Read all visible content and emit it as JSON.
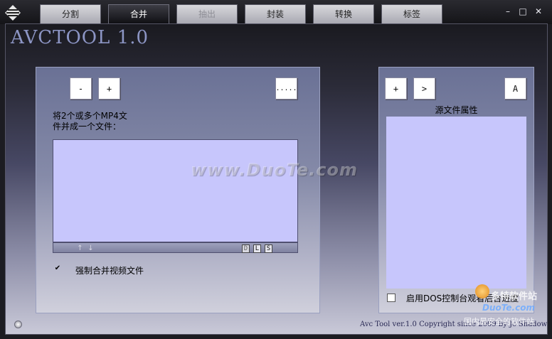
{
  "tabs": [
    {
      "label": "分割",
      "state": "normal"
    },
    {
      "label": "合并",
      "state": "active"
    },
    {
      "label": "抽出",
      "state": "disabled"
    },
    {
      "label": "封装",
      "state": "normal"
    },
    {
      "label": "转换",
      "state": "normal"
    },
    {
      "label": "标签",
      "state": "normal"
    }
  ],
  "window_controls": {
    "minimize": "–",
    "maximize": "□",
    "close": "✕"
  },
  "app_title": "AVCTOOL 1.0",
  "merge_panel": {
    "remove_label": "-",
    "add_label": "+",
    "browse_label": ".....",
    "instructions": "将2个或多个MP4文件并成一个文件：",
    "move_up": "↑",
    "move_down": "↓",
    "btn_d": "D",
    "btn_l": "L",
    "btn_s": "S",
    "force_merge_checked": "✔",
    "force_merge_label": "强制合并视频文件"
  },
  "source_panel": {
    "add_label": "+",
    "next_label": ">",
    "a_label": "A",
    "title": "源文件属性",
    "dos_label": "启用DOS控制台观看后台进度"
  },
  "status_text": "Avc Tool ver.1.0 Copyright since 2009 by Jc Shadow",
  "watermark": "www.DuoTe.com",
  "corner_watermark": {
    "line1": "多特软件站",
    "line2": "DuoTe.com",
    "line3": "国内最安全的软件站"
  },
  "colors": {
    "listbox": "#c7c6fc",
    "active_tab": "#1c1c22",
    "title": "#8c95c4"
  }
}
